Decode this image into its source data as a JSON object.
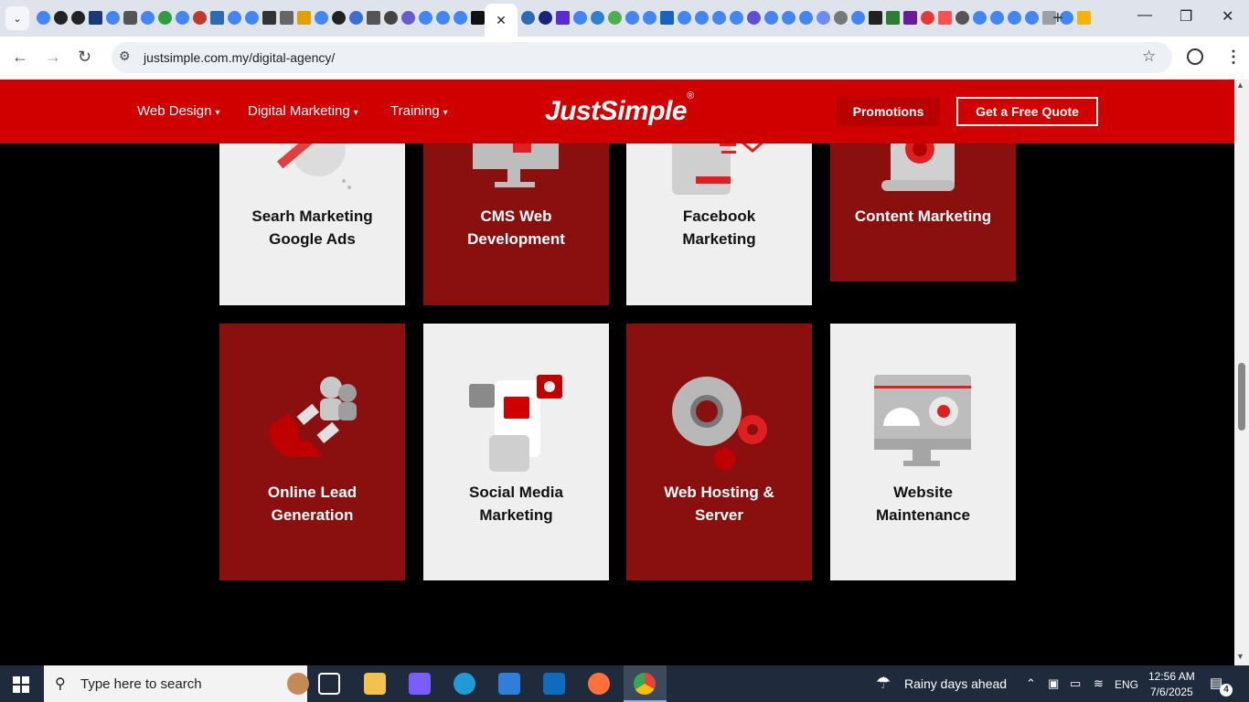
{
  "browser": {
    "url": "justsimple.com.my/digital-agency/",
    "new_tab_symbol": "+",
    "close_tab_symbol": "✕"
  },
  "header": {
    "nav": [
      "Web Design",
      "Digital Marketing",
      "Training"
    ],
    "logo": "JustSimple",
    "logo_mark": "®",
    "promotions": "Promotions",
    "quote": "Get a Free Quote"
  },
  "services": [
    {
      "title_l1": "Searh Marketing",
      "title_l2": "Google Ads",
      "theme": "light",
      "icon": "search-ads-icon"
    },
    {
      "title_l1": "CMS Web",
      "title_l2": "Development",
      "theme": "dark",
      "icon": "cms-monitor-icon"
    },
    {
      "title_l1": "Facebook",
      "title_l2": "Marketing",
      "theme": "light",
      "icon": "facebook-marketing-icon"
    },
    {
      "title_l1": "Content Marketing",
      "title_l2": "",
      "theme": "dark",
      "icon": "content-document-icon"
    },
    {
      "title_l1": "Online Lead",
      "title_l2": "Generation",
      "theme": "dark",
      "icon": "magnet-lead-icon"
    },
    {
      "title_l1": "Social Media",
      "title_l2": "Marketing",
      "theme": "light",
      "icon": "social-media-phone-icon"
    },
    {
      "title_l1": "Web Hosting &",
      "title_l2": "Server",
      "theme": "dark",
      "icon": "gears-hosting-icon"
    },
    {
      "title_l1": "Website",
      "title_l2": "Maintenance",
      "theme": "light",
      "icon": "maintenance-monitor-icon"
    }
  ],
  "taskbar": {
    "search_placeholder": "Type here to search",
    "weather": "Rainy days ahead",
    "lang": "ENG",
    "time": "12:56 AM",
    "date": "7/6/2025",
    "notifications": "4"
  },
  "colors": {
    "brand_red": "#d00000",
    "card_dark": "#8a0f0f",
    "card_light": "#efefef"
  }
}
